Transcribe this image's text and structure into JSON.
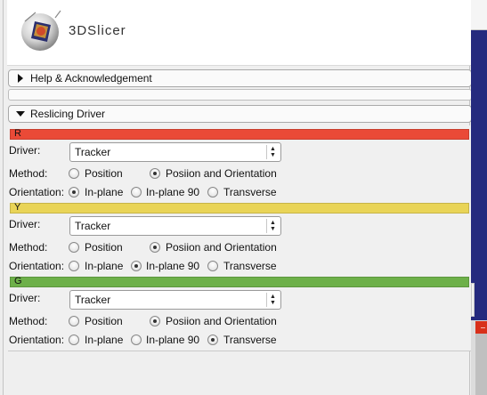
{
  "logo": {
    "text": "3DSlicer",
    "icon": "slicer-logo-icon"
  },
  "sections": {
    "help": {
      "label": "Help & Acknowledgement",
      "expanded": false
    },
    "reslicing": {
      "label": "Reslicing Driver",
      "expanded": true
    }
  },
  "colors": {
    "red": "#ea4a37",
    "yellow": "#e9d457",
    "green": "#6db049"
  },
  "labels": {
    "driver": "Driver:",
    "method": "Method:",
    "orientation": "Orientation:"
  },
  "options": {
    "method": [
      "Position",
      "Posiion and Orientation"
    ],
    "orientation": [
      "In-plane",
      "In-plane 90",
      "Transverse"
    ]
  },
  "slices": [
    {
      "name": "R",
      "driver": "Tracker",
      "method_selected": 1,
      "orientation_selected": 0
    },
    {
      "name": "Y",
      "driver": "Tracker",
      "method_selected": 1,
      "orientation_selected": 1
    },
    {
      "name": "G",
      "driver": "Tracker",
      "method_selected": 1,
      "orientation_selected": 2
    }
  ]
}
